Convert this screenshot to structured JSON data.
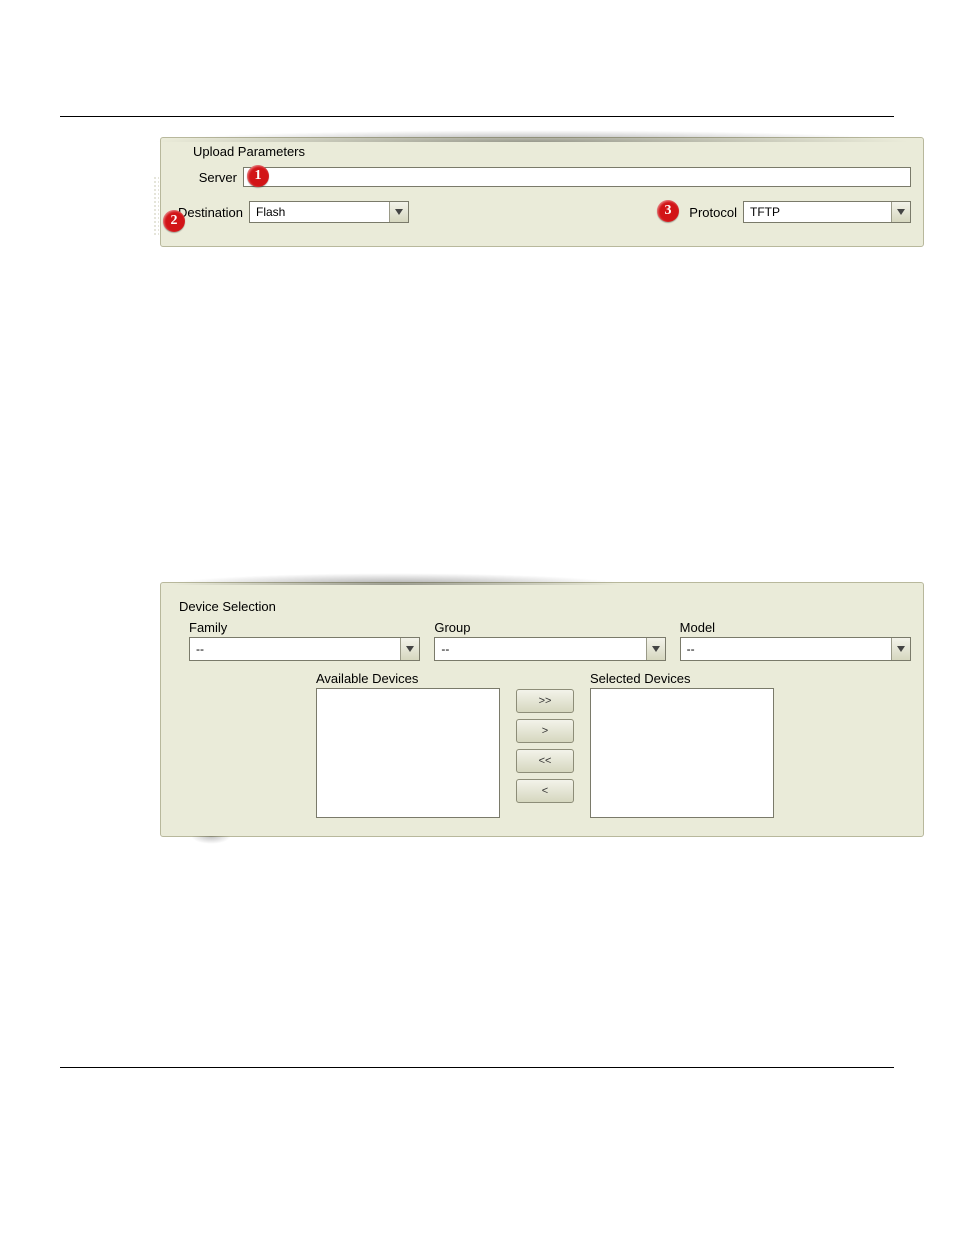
{
  "upload_panel": {
    "title": "Upload Parameters",
    "server_label": "Server",
    "server_value": "",
    "destination_label": "Destination",
    "destination_value": "Flash",
    "protocol_label": "Protocol",
    "protocol_value": "TFTP",
    "callouts": {
      "c1": "1",
      "c2": "2",
      "c3": "3"
    }
  },
  "device_panel": {
    "title": "Device Selection",
    "family_label": "Family",
    "family_value": "--",
    "group_label": "Group",
    "group_value": "--",
    "model_label": "Model",
    "model_value": "--",
    "available_label": "Available Devices",
    "selected_label": "Selected Devices",
    "buttons": {
      "add_all": ">>",
      "add_one": ">",
      "remove_all": "<<",
      "remove_one": "<"
    }
  }
}
